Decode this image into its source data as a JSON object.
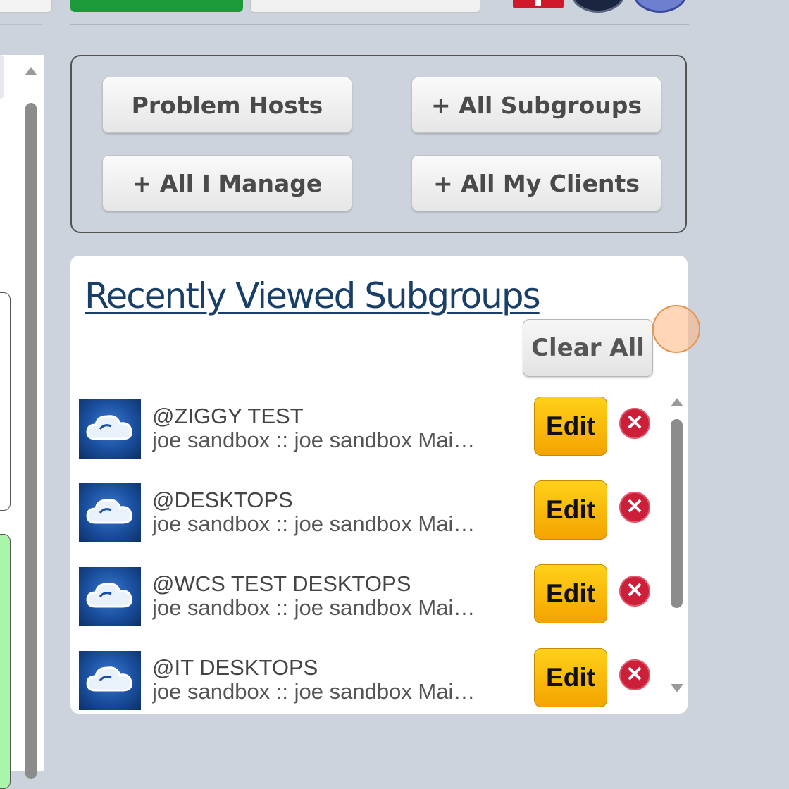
{
  "quick_buttons": {
    "problem_hosts": "Problem Hosts",
    "all_subgroups": "+ All Subgroups",
    "all_i_manage": "+ All I Manage",
    "all_my_clients": "+ All My Clients"
  },
  "recent": {
    "title": "Recently Viewed Subgroups",
    "clear_all": "Clear All",
    "items": [
      {
        "name": "@ZIGGY TEST",
        "path": "joe sandbox :: joe sandbox Mai…",
        "edit": "Edit",
        "remove": "✕"
      },
      {
        "name": "@DESKTOPS",
        "path": "joe sandbox :: joe sandbox Mai…",
        "edit": "Edit",
        "remove": "✕"
      },
      {
        "name": "@WCS TEST DESKTOPS",
        "path": "joe sandbox :: joe sandbox Mai…",
        "edit": "Edit",
        "remove": "✕"
      },
      {
        "name": "@IT DESKTOPS",
        "path": "joe sandbox :: joe sandbox Mai…",
        "edit": "Edit",
        "remove": "✕"
      }
    ],
    "thumb_icon": "cloud-icon"
  },
  "colors": {
    "background": "#cdd3dd",
    "title_link": "#193f68",
    "edit_button": "#ffc107",
    "remove_button": "#cc1f3a",
    "top_green_button": "#1c9a3a"
  }
}
